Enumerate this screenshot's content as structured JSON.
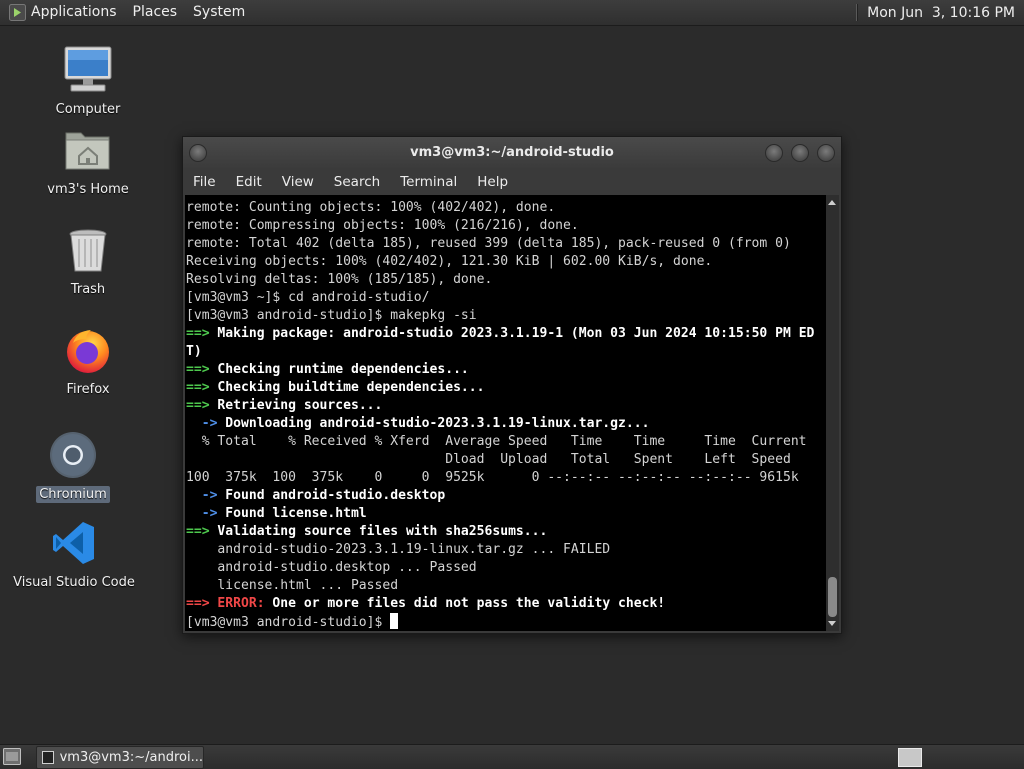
{
  "top_panel": {
    "menus": [
      "Applications",
      "Places",
      "System"
    ],
    "clock": "Mon Jun  3, 10:16 PM"
  },
  "desktop_icons": [
    {
      "label": "Computer",
      "icon": "computer-icon"
    },
    {
      "label": "vm3's Home",
      "icon": "home-folder-icon"
    },
    {
      "label": "Trash",
      "icon": "trash-icon"
    },
    {
      "label": "Firefox",
      "icon": "firefox-icon"
    },
    {
      "label": "Chromium",
      "icon": "chromium-icon",
      "selected": true
    },
    {
      "label": "Visual Studio Code",
      "icon": "vscode-icon"
    }
  ],
  "terminal": {
    "title": "vm3@vm3:~/android-studio",
    "menu": [
      "File",
      "Edit",
      "View",
      "Search",
      "Terminal",
      "Help"
    ],
    "lines": [
      "remote: Counting objects: 100% (402/402), done.",
      "remote: Compressing objects: 100% (216/216), done.",
      "remote: Total 402 (delta 185), reused 399 (delta 185), pack-reused 0 (from 0)",
      "Receiving objects: 100% (402/402), 121.30 KiB | 602.00 KiB/s, done.",
      "Resolving deltas: 100% (185/185), done.",
      "[vm3@vm3 ~]$ cd android-studio/",
      "[vm3@vm3 android-studio]$ makepkg -si",
      "==> Making package: android-studio 2023.3.1.19-1 (Mon 03 Jun 2024 10:15:50 PM ED",
      "T)",
      "==> Checking runtime dependencies...",
      "==> Checking buildtime dependencies...",
      "==> Retrieving sources...",
      "  -> Downloading android-studio-2023.3.1.19-linux.tar.gz...",
      "  % Total    % Received % Xferd  Average Speed   Time    Time     Time  Current",
      "                                 Dload  Upload   Total   Spent    Left  Speed",
      "100  375k  100  375k    0     0  9525k      0 --:--:-- --:--:-- --:--:-- 9615k",
      "  -> Found android-studio.desktop",
      "  -> Found license.html",
      "==> Validating source files with sha256sums...",
      "    android-studio-2023.3.1.19-linux.tar.gz ... FAILED",
      "    android-studio.desktop ... Passed",
      "    license.html ... Passed",
      "==> ERROR: One or more files did not pass the validity check!",
      "[vm3@vm3 android-studio]$ "
    ]
  },
  "taskbar": {
    "task_label": "vm3@vm3:~/androi..."
  },
  "colors": {
    "prompt_arrow": "#4ec94e",
    "sub_arrow": "#4f8fe8",
    "error": "#f04747",
    "terminal_bg": "#000000",
    "desktop_bg": "#2b2b2b"
  }
}
